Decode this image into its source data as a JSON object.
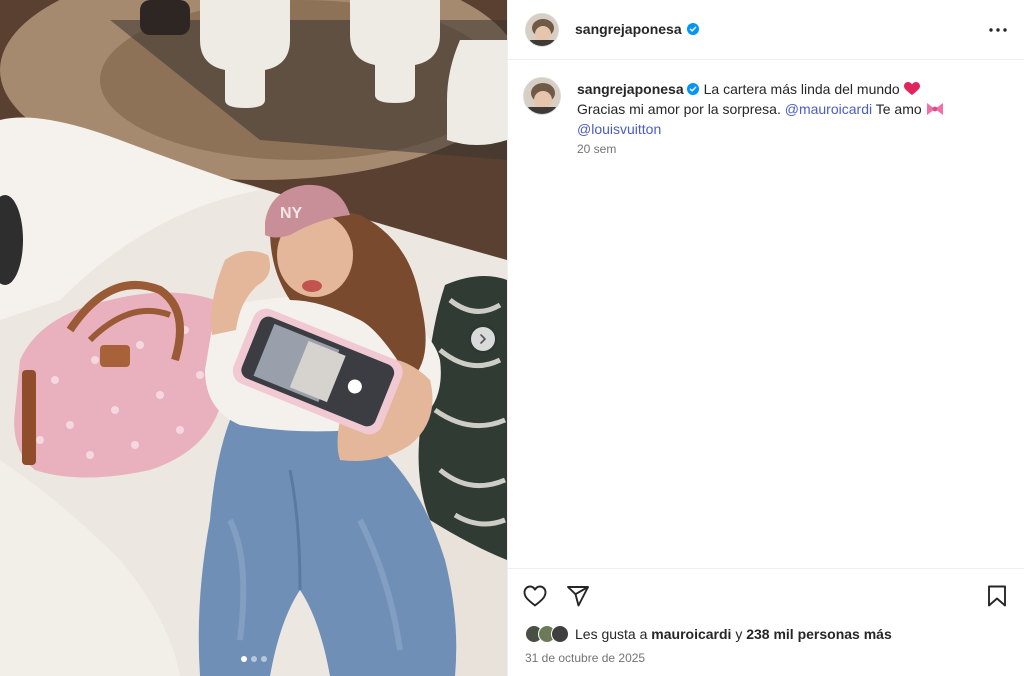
{
  "post": {
    "username": "sangrejaponesa",
    "verified": true
  },
  "caption": {
    "username": "sangrejaponesa",
    "line1": "La cartera más linda del mundo",
    "line2_a": "Gracias mi amor por la sorpresa.",
    "mention1": "@mauroicardi",
    "line2_b": "Te amo",
    "mention2": "@louisvuitton",
    "time_ago": "20 sem"
  },
  "carousel": {
    "total_slides": 3,
    "active_slide": 1
  },
  "likes": {
    "prefix": "Les gusta a",
    "user": "mauroicardi",
    "joiner": "y",
    "others": "238 mil personas más"
  },
  "date": "31 de octubre de 2025",
  "icons": {
    "more": "more-horizontal-icon",
    "like": "heart-icon",
    "share": "paper-plane-icon",
    "save": "bookmark-icon",
    "verified": "verified-badge-icon",
    "next": "chevron-right-icon"
  },
  "colors": {
    "verified": "#0095f6",
    "mention": "#4a5dc0",
    "secondary_text": "#737373",
    "heart_emoji": "#e0245e"
  }
}
